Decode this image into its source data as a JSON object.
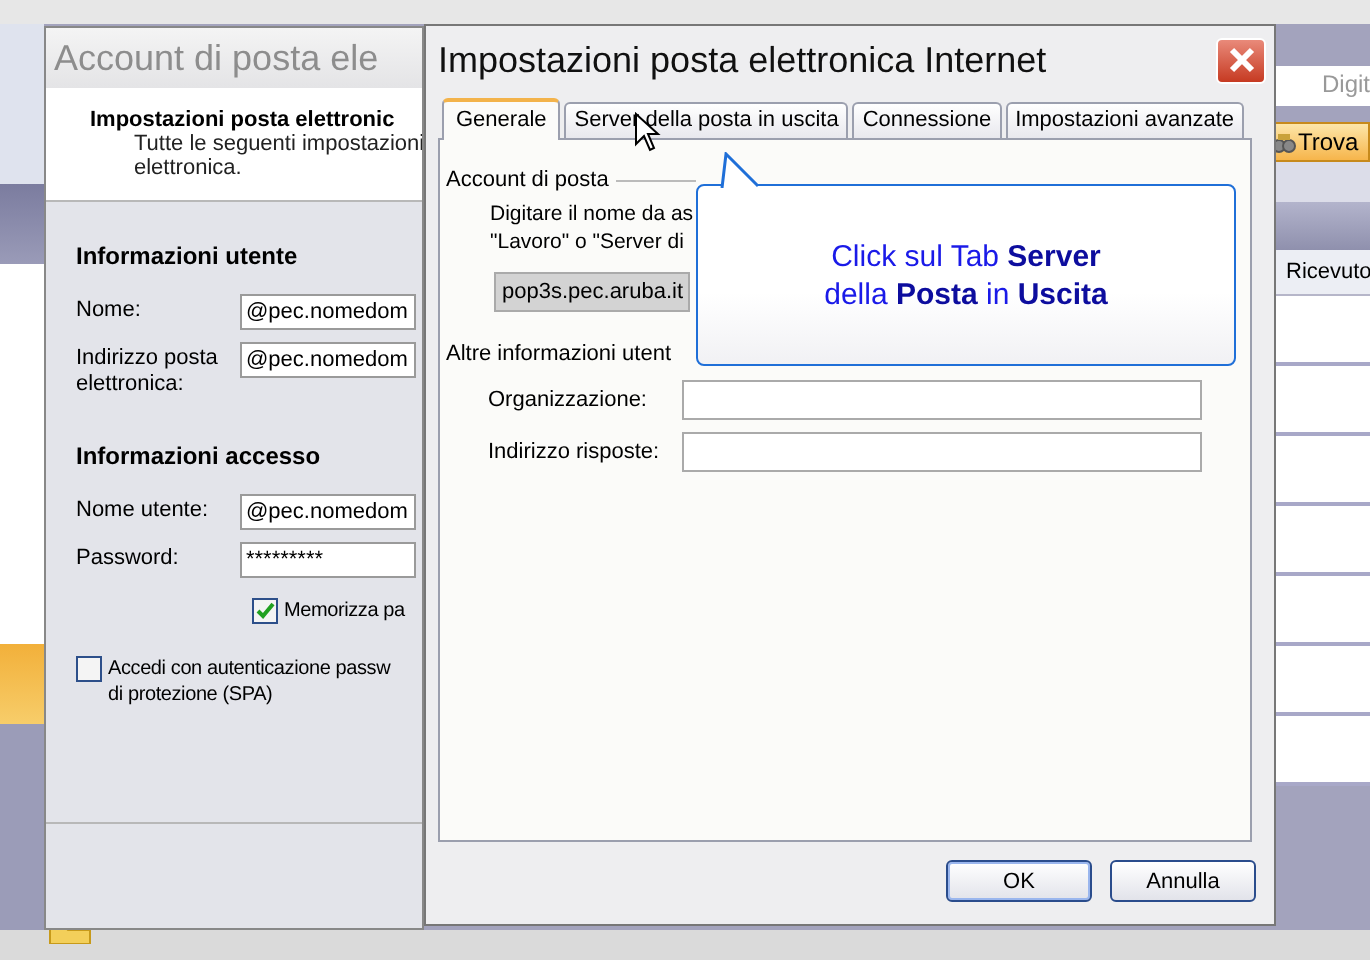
{
  "background_app": {
    "search_placeholder": "Digit",
    "find_button": "Trova",
    "columns": [
      "Ricevuto"
    ]
  },
  "account_dialog": {
    "title": "Account di posta ele",
    "header_title": "Impostazioni posta elettronic",
    "header_text": [
      "Tutte le seguenti impostazioni",
      "elettronica."
    ],
    "sections": [
      {
        "title": "Informazioni utente",
        "fields": [
          {
            "label": "Nome:",
            "value": "@pec.nomedom"
          },
          {
            "label": "Indirizzo posta elettronica:",
            "value": "@pec.nomedom"
          }
        ]
      },
      {
        "title": "Informazioni accesso",
        "fields": [
          {
            "label": "Nome utente:",
            "value": "@pec.nomedom"
          },
          {
            "label": "Password:",
            "value": "*********"
          }
        ]
      }
    ],
    "checkboxes": [
      {
        "label": "Memorizza pa",
        "checked": true,
        "kind": "indented"
      },
      {
        "label": "Accedi con autenticazione passw\ndi protezione (SPA)",
        "checked": false,
        "kind": "plain"
      }
    ]
  },
  "settings_dialog": {
    "title": "Impostazioni posta elettronica Internet",
    "tabs": [
      {
        "label": "Generale",
        "selected": true
      },
      {
        "label": "Server della posta in uscita",
        "selected": false
      },
      {
        "label": "Connessione",
        "selected": false
      },
      {
        "label": "Impostazioni avanzate",
        "selected": false
      }
    ],
    "account_group": {
      "title": "Account di posta",
      "text": [
        "Digitare il nome da as",
        "\"Lavoro\" o \"Server di"
      ],
      "value": "pop3s.pec.aruba.it"
    },
    "other_group": {
      "title": "Altre informazioni utent",
      "fields": [
        {
          "label": "Organizzazione:"
        },
        {
          "label": "Indirizzo risposte:"
        }
      ]
    },
    "buttons": [
      {
        "label": "OK",
        "kind": "default"
      },
      {
        "label": "Annulla",
        "kind": "normal"
      }
    ]
  },
  "callout": {
    "lines": [
      "Click sul Tab **Server**",
      "della **Posta** in **Uscita**"
    ]
  }
}
